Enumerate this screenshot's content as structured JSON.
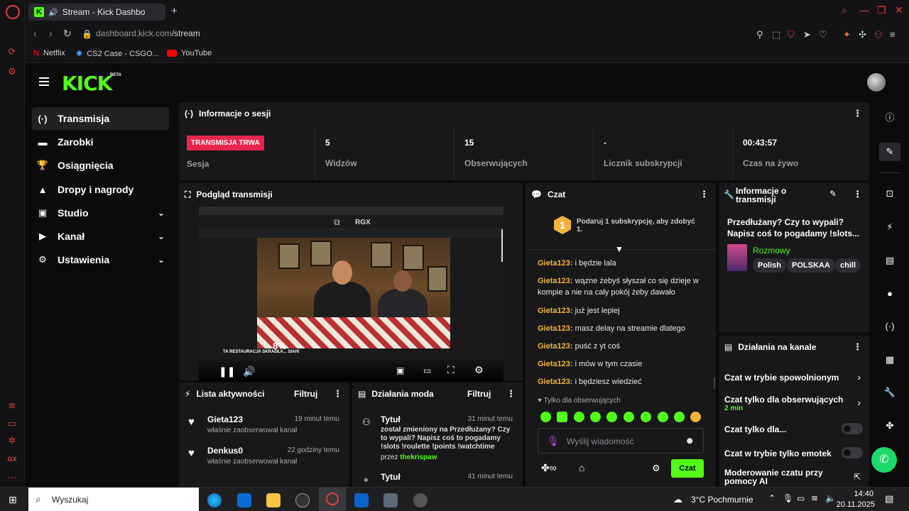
{
  "browser": {
    "tab_title": "Stream - Kick Dashbo",
    "url_host": "dashboard.kick.com",
    "url_path": "/stream",
    "bookmarks": [
      "Netflix",
      "CS2 Case - CSGO...",
      "YouTube"
    ]
  },
  "kick": {
    "logo": "KICK",
    "beta": "BETA"
  },
  "nav": {
    "items": [
      {
        "label": "Transmisja",
        "icon": "broadcast-icon"
      },
      {
        "label": "Zarobki",
        "icon": "money-icon"
      },
      {
        "label": "Osiągnięcia",
        "icon": "trophy-icon"
      },
      {
        "label": "Dropy i nagrody",
        "icon": "gift-icon"
      },
      {
        "label": "Studio",
        "icon": "studio-icon"
      },
      {
        "label": "Kanał",
        "icon": "channel-icon"
      },
      {
        "label": "Ustawienia",
        "icon": "settings-icon"
      }
    ]
  },
  "session": {
    "title": "Informacje o sesji",
    "live_badge": "TRANSMISJA TRWA",
    "session_label": "Sesja",
    "stats": [
      {
        "value": "5",
        "label": "Widzów"
      },
      {
        "value": "15",
        "label": "Obserwujących"
      },
      {
        "value": "-",
        "label": "Licznik subskrypcji"
      },
      {
        "value": "00:43:57",
        "label": "Czas na żywo"
      }
    ]
  },
  "preview": {
    "title": "Podgląd transmisji",
    "overlay_label": "RGX",
    "progress": "8%",
    "caption": "TA RESTAURACJA SKRADŁA... SIAH!"
  },
  "chat": {
    "title": "Czat",
    "sub_goal": "Podaruj 1 subskrypcję, aby zdobyć 1.",
    "goal_number": "1",
    "messages": [
      {
        "user": "Gieta123:",
        "text": " i będzie lala"
      },
      {
        "user": "Gieta123:",
        "text": " wązne żebyś słyszał co się dzieje w kompie a nie na cały pokój żeby dawało"
      },
      {
        "user": "Gieta123:",
        "text": " już jest lepiej"
      },
      {
        "user": "Gieta123:",
        "text": " masz delay na streamie dlatego"
      },
      {
        "user": "Gieta123:",
        "text": " puść z yt coś"
      },
      {
        "user": "Gieta123:",
        "text": " i mów w tym czasie"
      },
      {
        "user": "Gieta123:",
        "text": " i będziesz wiedzieć"
      }
    ],
    "followers_only": "Tylko dla obserwujących",
    "input_placeholder": "Wyślij wiadomość",
    "send_label": "Czat"
  },
  "stream_info": {
    "title": "Informacje o transmisji",
    "stream_title": "Przedłużany? Czy to wypali? Napisz coś to pogadamy !slots...",
    "category": "Rozmowy",
    "tags": [
      "Polish",
      "POLSKAA",
      "chill"
    ]
  },
  "channel_actions": {
    "title": "Działania na kanale",
    "items": [
      {
        "label": "Czat w trybie spowolnionym",
        "sub": ""
      },
      {
        "label": "Czat tylko dla obserwujących",
        "sub": "2 min"
      },
      {
        "label": "Czat tylko dla...",
        "sub": ""
      },
      {
        "label": "Czat w trybie tylko emotek",
        "sub": ""
      },
      {
        "label": "Moderowanie czatu przy pomocy AI",
        "sub": ""
      }
    ]
  },
  "activity": {
    "title": "Lista aktywności",
    "filter": "Filtruj",
    "items": [
      {
        "user": "Gieta123",
        "action": "właśnie zaobserwował kanał",
        "time": "19 minut temu"
      },
      {
        "user": "Denkus0",
        "action": "właśnie zaobserwował kanał",
        "time": "22 godziny temu"
      }
    ]
  },
  "mod": {
    "title": "Działania moda",
    "filter": "Filtruj",
    "items": [
      {
        "title": "Tytuł",
        "time": "31 minut temu",
        "text": "został zmieniony na Przedłużany? Czy to wypali? Napisz coś to pogadamy !slots !roulette !points !watchtime",
        "by": "przez",
        "author": "thekrispaw"
      },
      {
        "title": "Tytuł",
        "time": "41 minut temu"
      }
    ]
  },
  "taskbar": {
    "search": "Wyszukaj",
    "weather": "3°C Pochmurnie",
    "time": "14:40",
    "date": "20.11.2025"
  }
}
